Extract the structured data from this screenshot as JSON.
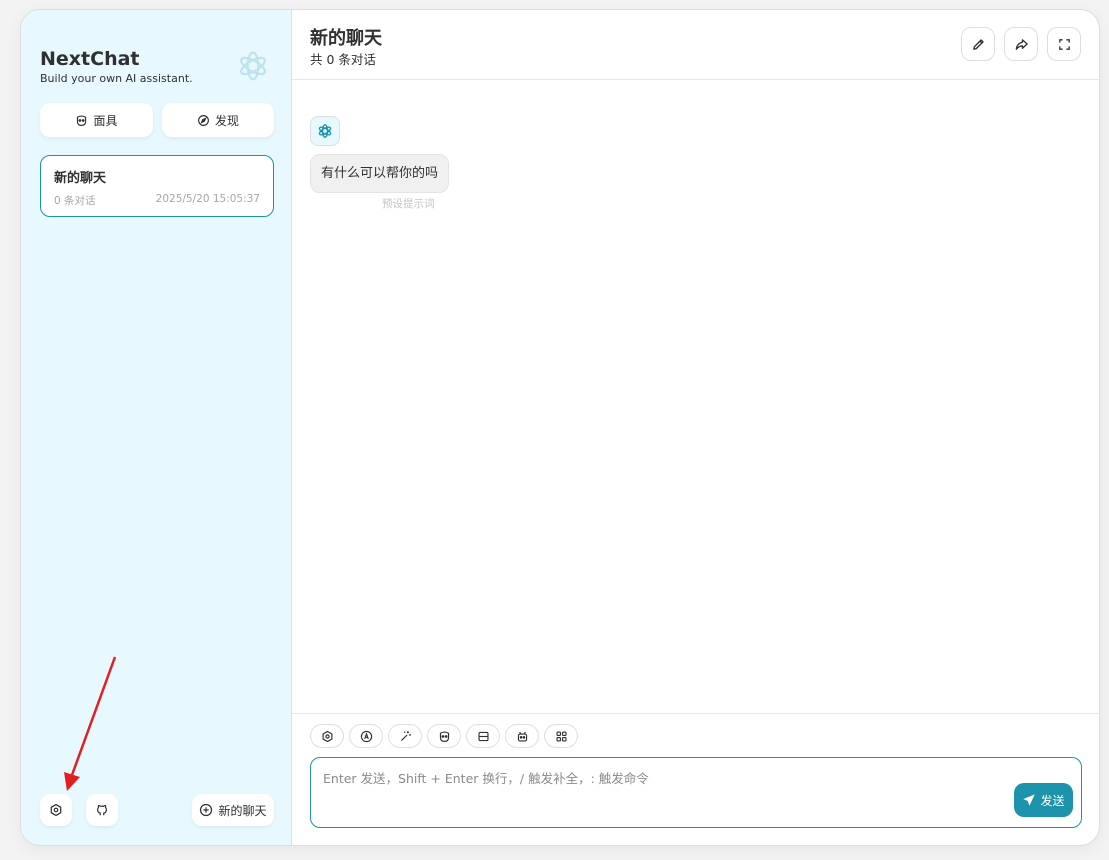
{
  "sidebar": {
    "title": "NextChat",
    "subtitle": "Build your own AI assistant.",
    "logo_icon": "openai-logo-icon",
    "buttons": [
      {
        "label": "面具",
        "icon": "mask-icon"
      },
      {
        "label": "发现",
        "icon": "compass-icon"
      }
    ],
    "chat_list": [
      {
        "title": "新的聊天",
        "count": "0 条对话",
        "time": "2025/5/20 15:05:37"
      }
    ],
    "footer": {
      "settings_icon": "settings-icon",
      "github_icon": "github-icon",
      "new_chat_label": "新的聊天",
      "new_chat_icon": "add-icon"
    }
  },
  "header": {
    "title": "新的聊天",
    "subtitle": "共 0 条对话",
    "buttons": [
      "edit-icon",
      "share-icon",
      "fullscreen-icon"
    ]
  },
  "messages": [
    {
      "role": "assistant",
      "avatar_icon": "openai-logo-icon",
      "text": "有什么可以帮你的吗",
      "meta": "预设提示词"
    }
  ],
  "input": {
    "placeholder": "Enter 发送，Shift + Enter 换行，/ 触发补全，: 触发命令",
    "value": "",
    "send_label": "发送",
    "actions": [
      "settings-icon",
      "prompt-icon",
      "magic-wand-icon",
      "mask-icon",
      "context-icon",
      "robot-icon",
      "apps-icon"
    ]
  },
  "colors": {
    "primary": "#1d93ab",
    "sidebar_bg": "#e7f8ff",
    "annotation_arrow": "#e02020"
  }
}
